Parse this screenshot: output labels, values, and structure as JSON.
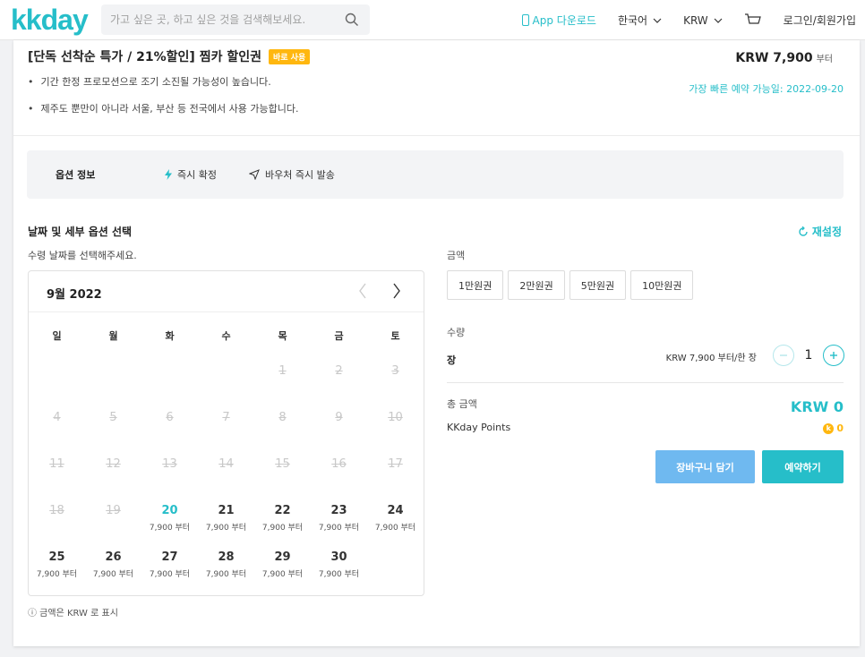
{
  "header": {
    "logo": "kkday",
    "search_placeholder": "가고 싶은 곳, 하고 싶은 것을 검색해보세요.",
    "nav": {
      "app_download": "App 다운로드",
      "language": "한국어",
      "currency": "KRW",
      "login": "로그인/회원가입"
    }
  },
  "product": {
    "title": "[단독 선착순 특가 / 21%할인] 찜카 할인권",
    "badge": "바로 사용",
    "bullets": [
      "기간 한정 프로모션으로 조기 소진될 가능성이 높습니다.",
      "제주도 뿐만이 아니라 서울, 부산 등 전국에서 사용 가능합니다."
    ],
    "price": "KRW 7,900",
    "price_suffix": "부터",
    "earliest": "가장 빠른 예약 가능일: 2022-09-20"
  },
  "options": {
    "title": "옵션 정보",
    "instant_confirm": "즉시 확정",
    "instant_voucher": "바우처 즉시 발송"
  },
  "select": {
    "title": "날짜 및 세부 옵션 선택",
    "reset": "재설정",
    "hint": "수령 날짜를 선택해주세요."
  },
  "calendar": {
    "month": "9월 2022",
    "weekdays": [
      "일",
      "월",
      "화",
      "수",
      "목",
      "금",
      "토"
    ],
    "price_label": "7,900 부터",
    "days": [
      {
        "d": "",
        "s": "empty"
      },
      {
        "d": "",
        "s": "empty"
      },
      {
        "d": "",
        "s": "empty"
      },
      {
        "d": "",
        "s": "empty"
      },
      {
        "d": "1",
        "s": "off"
      },
      {
        "d": "2",
        "s": "off"
      },
      {
        "d": "3",
        "s": "off"
      },
      {
        "d": "4",
        "s": "off"
      },
      {
        "d": "5",
        "s": "off"
      },
      {
        "d": "6",
        "s": "off"
      },
      {
        "d": "7",
        "s": "off"
      },
      {
        "d": "8",
        "s": "off"
      },
      {
        "d": "9",
        "s": "off"
      },
      {
        "d": "10",
        "s": "off"
      },
      {
        "d": "11",
        "s": "off"
      },
      {
        "d": "12",
        "s": "off"
      },
      {
        "d": "13",
        "s": "off"
      },
      {
        "d": "14",
        "s": "off"
      },
      {
        "d": "15",
        "s": "off"
      },
      {
        "d": "16",
        "s": "off"
      },
      {
        "d": "17",
        "s": "off"
      },
      {
        "d": "18",
        "s": "off"
      },
      {
        "d": "19",
        "s": "off"
      },
      {
        "d": "20",
        "s": "today"
      },
      {
        "d": "21",
        "s": "on"
      },
      {
        "d": "22",
        "s": "on"
      },
      {
        "d": "23",
        "s": "on"
      },
      {
        "d": "24",
        "s": "on"
      },
      {
        "d": "25",
        "s": "on"
      },
      {
        "d": "26",
        "s": "on"
      },
      {
        "d": "27",
        "s": "on"
      },
      {
        "d": "28",
        "s": "on"
      },
      {
        "d": "29",
        "s": "on"
      },
      {
        "d": "30",
        "s": "on"
      }
    ]
  },
  "note": "ⓘ 금액은 KRW 로 표시",
  "panel": {
    "amount_label": "금액",
    "vouchers": [
      "1만원권",
      "2만원권",
      "5만원권",
      "10만원권"
    ],
    "quantity_label": "수량",
    "unit_label": "장",
    "unit_price": "KRW 7,900 부터/한 장",
    "quantity": "1",
    "total_label": "총 금액",
    "total_value": "KRW 0",
    "points_label": "KKday Points",
    "points_value": "0",
    "cart_button": "장바구니 담기",
    "book_button": "예약하기"
  },
  "colors": {
    "brand": "#26bec9",
    "badge": "#ffb70f",
    "cart": "#6fb9f0"
  }
}
